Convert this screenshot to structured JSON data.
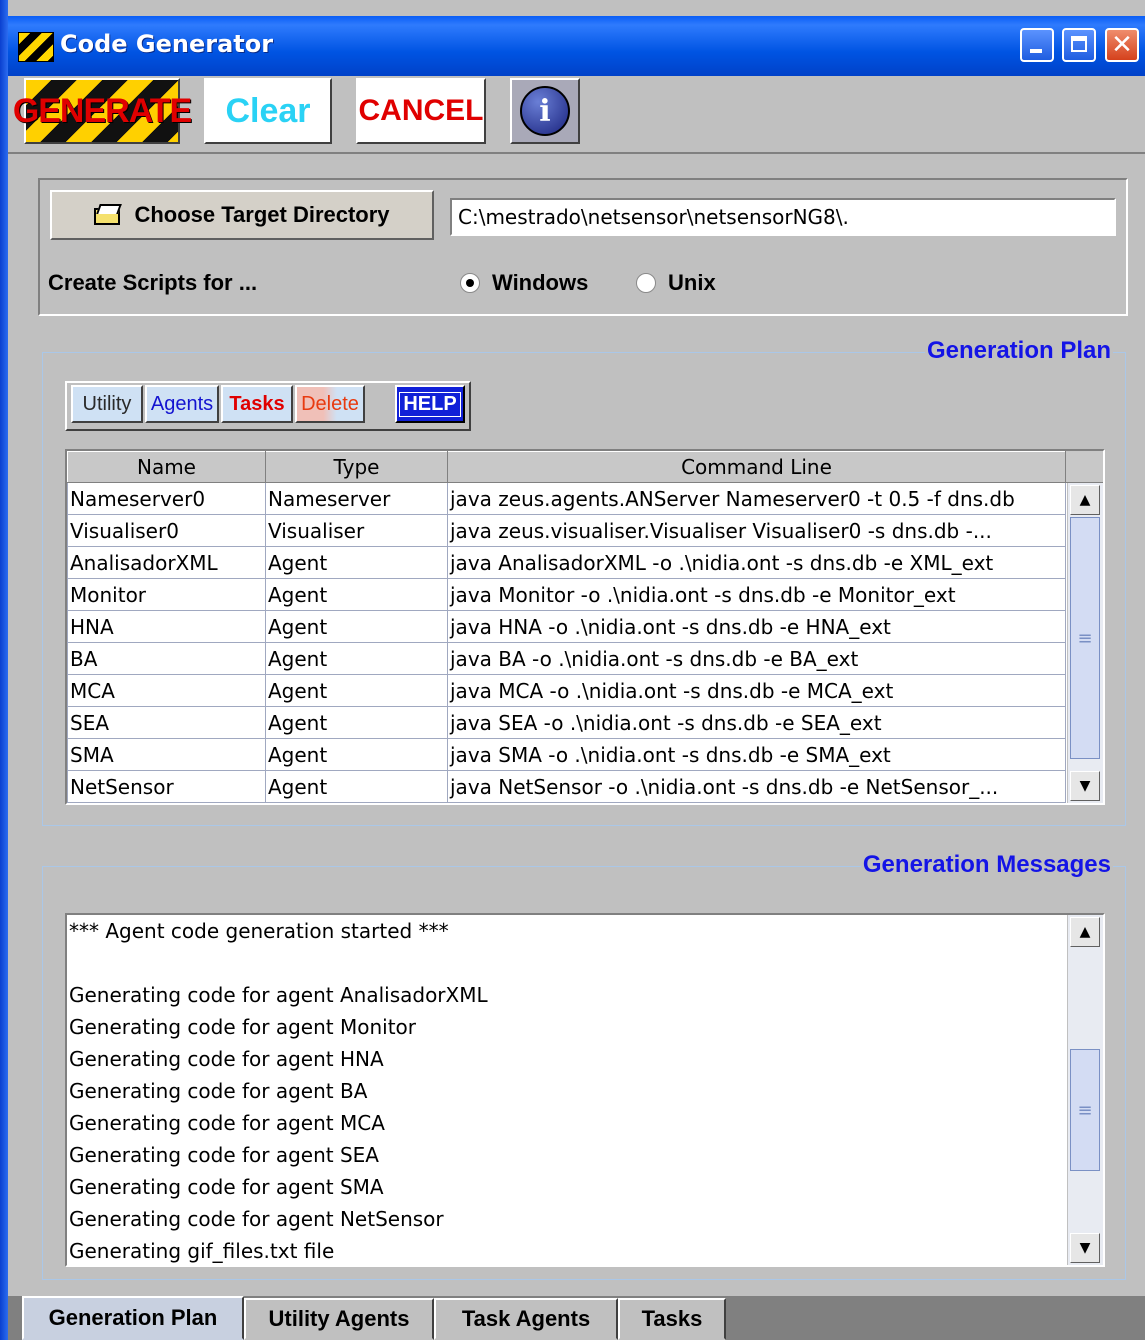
{
  "window": {
    "title": "Code Generator"
  },
  "toolbar": {
    "generate_label": "GENERATE",
    "clear_label": "Clear",
    "cancel_label": "CANCEL",
    "info_icon": "info-icon"
  },
  "target": {
    "choose_label": "Choose Target Directory",
    "path_value": "C:\\mestrado\\netsensor\\netsensorNG8\\.",
    "scripts_label": "Create Scripts for ...",
    "options": [
      "Windows",
      "Unix"
    ],
    "selected": "Windows"
  },
  "plan": {
    "title": "Generation Plan",
    "buttons": {
      "utility": "Utility",
      "agents": "Agents",
      "tasks": "Tasks",
      "delete": "Delete",
      "help": "HELP"
    },
    "columns": [
      "Name",
      "Type",
      "Command Line"
    ],
    "rows": [
      [
        "Nameserver0",
        "Nameserver",
        "java zeus.agents.ANServer Nameserver0 -t 0.5 -f dns.db"
      ],
      [
        "Visualiser0",
        "Visualiser",
        "java zeus.visualiser.Visualiser Visualiser0 -s dns.db -..."
      ],
      [
        "AnalisadorXML",
        "Agent",
        "java AnalisadorXML -o .\\nidia.ont -s dns.db -e XML_ext"
      ],
      [
        "Monitor",
        "Agent",
        "java Monitor -o .\\nidia.ont -s dns.db -e Monitor_ext"
      ],
      [
        "HNA",
        "Agent",
        "java HNA -o .\\nidia.ont -s dns.db -e HNA_ext"
      ],
      [
        "BA",
        "Agent",
        "java BA -o .\\nidia.ont -s dns.db -e BA_ext"
      ],
      [
        "MCA",
        "Agent",
        "java MCA -o .\\nidia.ont -s dns.db -e MCA_ext"
      ],
      [
        "SEA",
        "Agent",
        "java SEA -o .\\nidia.ont -s dns.db -e SEA_ext"
      ],
      [
        "SMA",
        "Agent",
        "java SMA -o .\\nidia.ont -s dns.db -e SMA_ext"
      ],
      [
        "NetSensor",
        "Agent",
        "java NetSensor -o .\\nidia.ont -s dns.db -e NetSensor_..."
      ]
    ]
  },
  "messages": {
    "title": "Generation Messages",
    "lines": [
      "*** Agent code generation started ***",
      "",
      "Generating code for agent AnalisadorXML",
      "Generating code for agent Monitor",
      "Generating code for agent HNA",
      "Generating code for agent BA",
      "Generating code for agent MCA",
      "Generating code for agent SEA",
      "Generating code for agent SMA",
      "Generating code for agent NetSensor",
      "Generating gif_files.txt file"
    ]
  },
  "tabs": [
    "Generation Plan",
    "Utility Agents",
    "Task Agents",
    "Tasks"
  ],
  "active_tab": "Generation Plan",
  "colors": {
    "title_bar": "#0054e3",
    "group_title": "#1414e6",
    "danger": "#e00000",
    "clear": "#2ad2f5"
  }
}
